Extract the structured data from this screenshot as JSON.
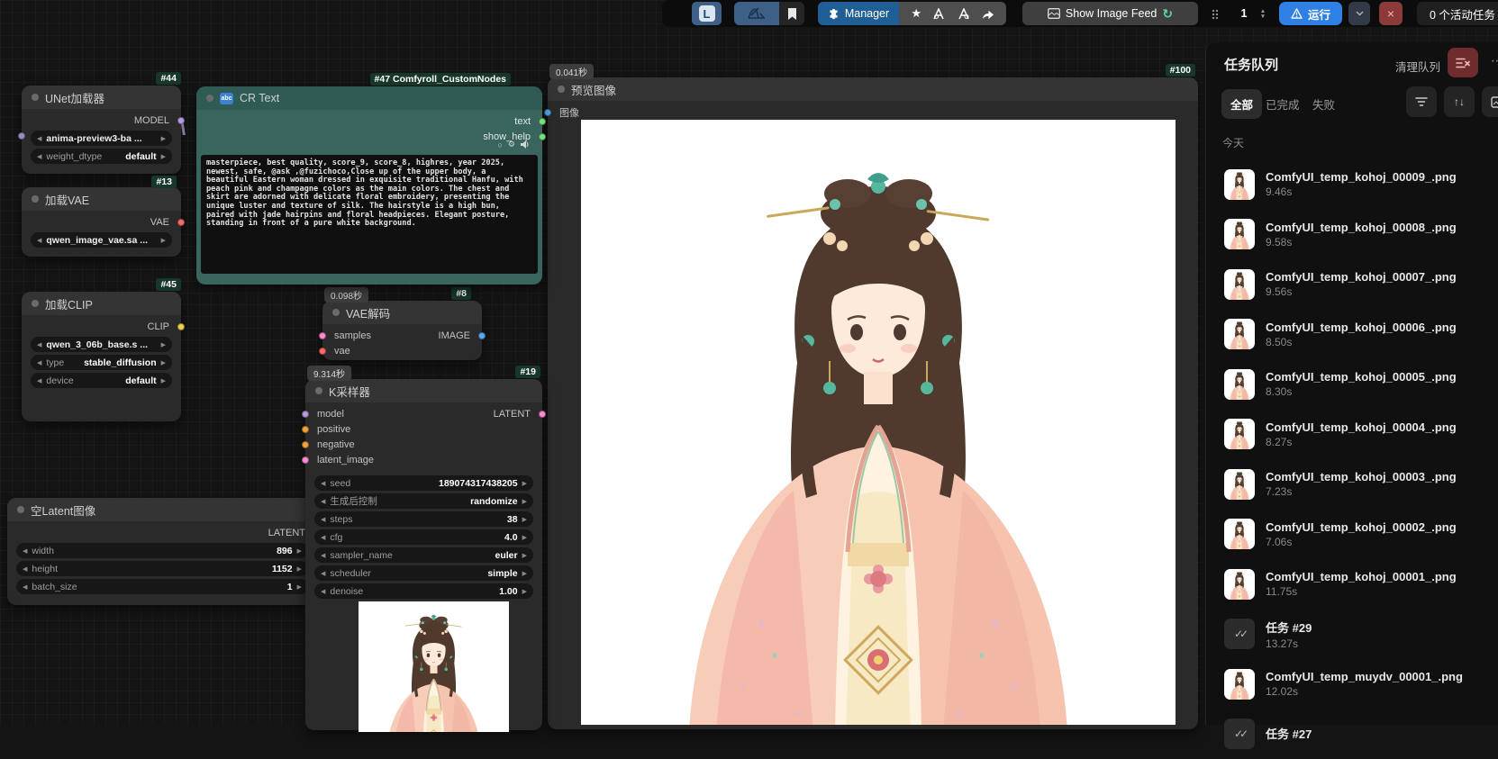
{
  "toolbar": {
    "logo_letter": "L",
    "manager_label": "Manager",
    "show_image_feed_label": "Show Image Feed",
    "batch_count": "1",
    "run_label": "运行",
    "active_tasks": "0 个活动任务"
  },
  "colors": {
    "model_slot": "#b39ddb",
    "clip_slot": "#f2d14a",
    "vae_slot": "#ff6b6b",
    "latent_slot": "#ff8bd1",
    "image_slot": "#58aaf2",
    "conditioning_slot": "#f7a03c",
    "text_slot": "#79e07e",
    "run_button": "#2f80e4",
    "manager_button": "#1f5f96",
    "danger_button": "#8c3a3a",
    "cr_node_teal": "#39655e",
    "badge_green": "#17372a"
  },
  "icons": [
    "comfy-logo-icon",
    "workflow-icon",
    "bookmark-icon",
    "puzzle-icon",
    "star-icon",
    "model-a-icon",
    "model-a2-icon",
    "share-icon",
    "image-feed-icon",
    "refresh-green-icon",
    "drag-handle-icon",
    "warning-icon",
    "chevron-down-icon",
    "close-icon",
    "filter-icon",
    "sort-icon",
    "clear-queue-icon",
    "check-double-icon",
    "gear-icon",
    "speaker-icon"
  ],
  "nodes": {
    "unet": {
      "badge": "#44",
      "title": "UNet加载器",
      "output": "MODEL",
      "widget1": "anima-preview3-ba ...",
      "widget2_label": "weight_dtype",
      "widget2_value": "default"
    },
    "load_vae": {
      "badge": "#13",
      "title": "加载VAE",
      "output": "VAE",
      "widget1": "qwen_image_vae.sa ..."
    },
    "load_clip": {
      "badge": "#45",
      "title": "加载CLIP",
      "output": "CLIP",
      "widget1": "qwen_3_06b_base.s ...",
      "widget2_label": "type",
      "widget2_value": "stable_diffusion",
      "widget3_label": "device",
      "widget3_value": "default"
    },
    "cr_text": {
      "badge": "#47 Comfyroll_CustomNodes",
      "title": "CR Text",
      "output1": "text",
      "output2": "show_help",
      "prompt": "masterpiece, best quality, score_9, score_8, highres, year 2025, newest, safe, @ask ,@fuzichoco,Close up of the upper body, a beautiful Eastern woman dressed in exquisite traditional Hanfu, with peach pink and champagne colors as the main colors. The chest and skirt are adorned with delicate floral embroidery, presenting the unique luster and texture of silk. The hairstyle is a high bun, paired with jade hairpins and floral headpieces. Elegant posture, standing in front of a pure white background."
    },
    "vae_decode": {
      "badge": "#8",
      "timing": "0.098秒",
      "title": "VAE解码",
      "input1": "samples",
      "input2": "vae",
      "output": "IMAGE"
    },
    "ksampler": {
      "badge": "#19",
      "timing": "9.314秒",
      "title": "K采样器",
      "output": "LATENT",
      "inputs": [
        {
          "label": "model"
        },
        {
          "label": "positive"
        },
        {
          "label": "negative"
        },
        {
          "label": "latent_image"
        }
      ],
      "widgets": [
        {
          "label": "seed",
          "value": "189074317438205"
        },
        {
          "label": "生成后控制",
          "value": "randomize"
        },
        {
          "label": "steps",
          "value": "38"
        },
        {
          "label": "cfg",
          "value": "4.0"
        },
        {
          "label": "sampler_name",
          "value": "euler"
        },
        {
          "label": "scheduler",
          "value": "simple"
        },
        {
          "label": "denoise",
          "value": "1.00"
        }
      ]
    },
    "empty_latent": {
      "title": "空Latent图像",
      "output": "LATENT",
      "widgets": [
        {
          "label": "width",
          "value": "896"
        },
        {
          "label": "height",
          "value": "1152"
        },
        {
          "label": "batch_size",
          "value": "1"
        }
      ]
    },
    "preview": {
      "badge": "#100",
      "timing": "0.041秒",
      "title": "预览图像",
      "input": "图像"
    }
  },
  "queue": {
    "title": "任务队列",
    "clear_label": "清理队列",
    "filters": [
      "全部",
      "已完成",
      "失败"
    ],
    "section_label": "今天",
    "items": [
      {
        "type": "image",
        "name": "ComfyUI_temp_kohoj_00009_.png",
        "time": "9.46s"
      },
      {
        "type": "image",
        "name": "ComfyUI_temp_kohoj_00008_.png",
        "time": "9.58s"
      },
      {
        "type": "image",
        "name": "ComfyUI_temp_kohoj_00007_.png",
        "time": "9.56s"
      },
      {
        "type": "image",
        "name": "ComfyUI_temp_kohoj_00006_.png",
        "time": "8.50s"
      },
      {
        "type": "image",
        "name": "ComfyUI_temp_kohoj_00005_.png",
        "time": "8.30s"
      },
      {
        "type": "image",
        "name": "ComfyUI_temp_kohoj_00004_.png",
        "time": "8.27s"
      },
      {
        "type": "image",
        "name": "ComfyUI_temp_kohoj_00003_.png",
        "time": "7.23s"
      },
      {
        "type": "image",
        "name": "ComfyUI_temp_kohoj_00002_.png",
        "time": "7.06s"
      },
      {
        "type": "image",
        "name": "ComfyUI_temp_kohoj_00001_.png",
        "time": "11.75s"
      },
      {
        "type": "task",
        "name": "任务 #29",
        "time": "13.27s"
      },
      {
        "type": "image",
        "name": "ComfyUI_temp_muydv_00001_.png",
        "time": "12.02s"
      },
      {
        "type": "task",
        "name": "任务 #27",
        "time": ""
      }
    ]
  }
}
